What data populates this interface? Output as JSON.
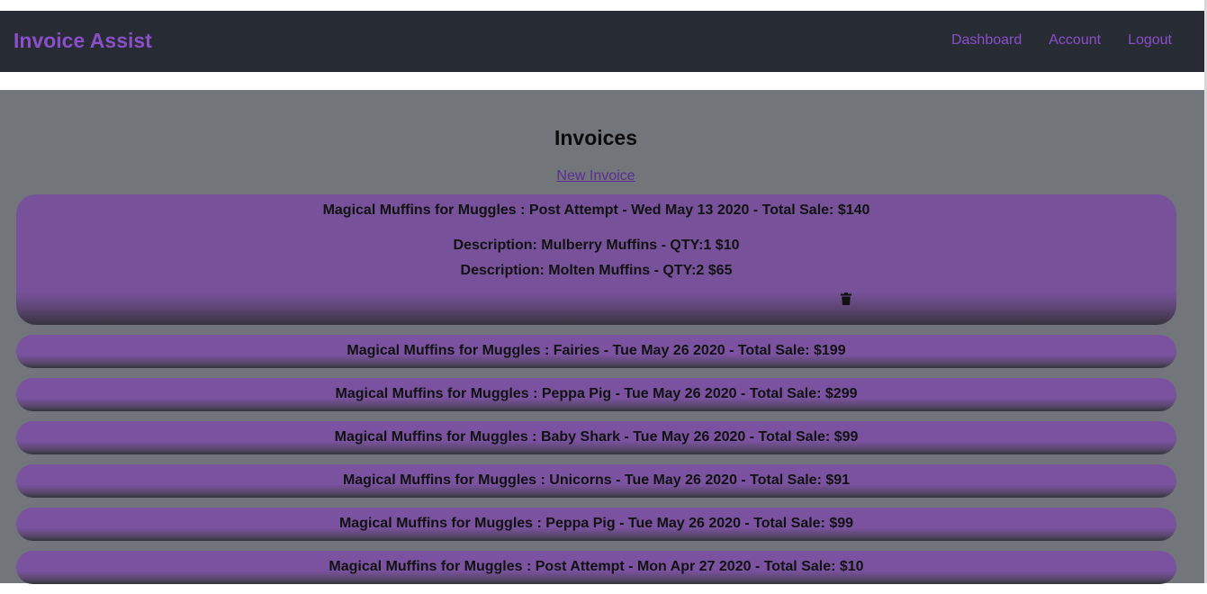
{
  "header": {
    "brand": "Invoice Assist",
    "nav": [
      "Dashboard",
      "Account",
      "Logout"
    ]
  },
  "main": {
    "title": "Invoices",
    "new_invoice_label": "New Invoice"
  },
  "invoices": [
    {
      "title": "Magical Muffins for Muggles : Post Attempt - Wed May 13 2020 - Total Sale: $140",
      "expanded": true,
      "items": [
        "Description: Mulberry Muffins - QTY:1 $10",
        "Description: Molten Muffins - QTY:2 $65"
      ]
    },
    {
      "title": "Magical Muffins for Muggles : Fairies - Tue May 26 2020 - Total Sale: $199"
    },
    {
      "title": "Magical Muffins for Muggles : Peppa Pig - Tue May 26 2020 - Total Sale: $299"
    },
    {
      "title": "Magical Muffins for Muggles : Baby Shark - Tue May 26 2020 - Total Sale: $99"
    },
    {
      "title": "Magical Muffins for Muggles : Unicorns - Tue May 26 2020 - Total Sale: $91"
    },
    {
      "title": "Magical Muffins for Muggles : Peppa Pig - Tue May 26 2020 - Total Sale: $99"
    },
    {
      "title": "Magical Muffins for Muggles : Post Attempt - Mon Apr 27 2020 - Total Sale: $10"
    }
  ],
  "icons": {
    "delete": "trash-icon"
  },
  "colors": {
    "navbar": "#272b33",
    "brand": "#8a4fc8",
    "content_bg": "#727579",
    "invoice_card": "#7a52a0"
  }
}
